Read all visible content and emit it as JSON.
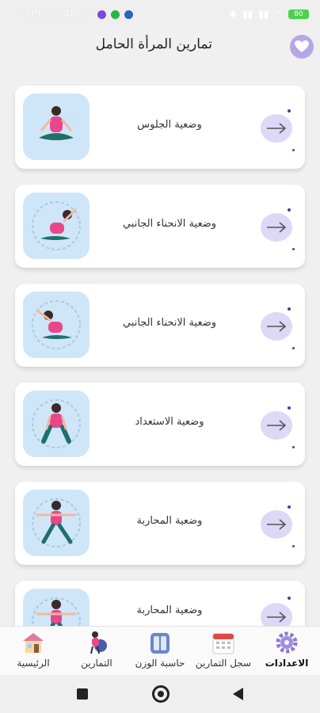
{
  "status": {
    "time": "12:09",
    "speed": "2.4KB/s",
    "battery": "80"
  },
  "header": {
    "title": "تمارين المرأة الحامل"
  },
  "exercises": [
    {
      "label": "وضعية الجلوس",
      "thumb": "seated-pose-illustration"
    },
    {
      "label": "وضعية الانحناء الجانبي",
      "thumb": "side-bend-pose-illustration"
    },
    {
      "label": "وضعية الانحناء الجانبي",
      "thumb": "side-bend-pose-illustration"
    },
    {
      "label": "وضعية الاستعداد",
      "thumb": "ready-pose-illustration"
    },
    {
      "label": "وضعية المحاربة",
      "thumb": "warrior-pose-illustration"
    },
    {
      "label": "وضعية المحاربة",
      "thumb": "warrior-pose-illustration"
    }
  ],
  "nav": {
    "home": "الرئيسية",
    "exercises": "التمارين",
    "weight": "حاسبة الوزن",
    "log": "سجل التمارين",
    "settings": "الاعدادات"
  },
  "colors": {
    "accent": "#b6a6e6",
    "arrow_bg": "#ddd8f6",
    "thumb_bg": "#cfe6f8",
    "figure_shirt": "#e8488a",
    "figure_pants": "#1f6f6a"
  }
}
